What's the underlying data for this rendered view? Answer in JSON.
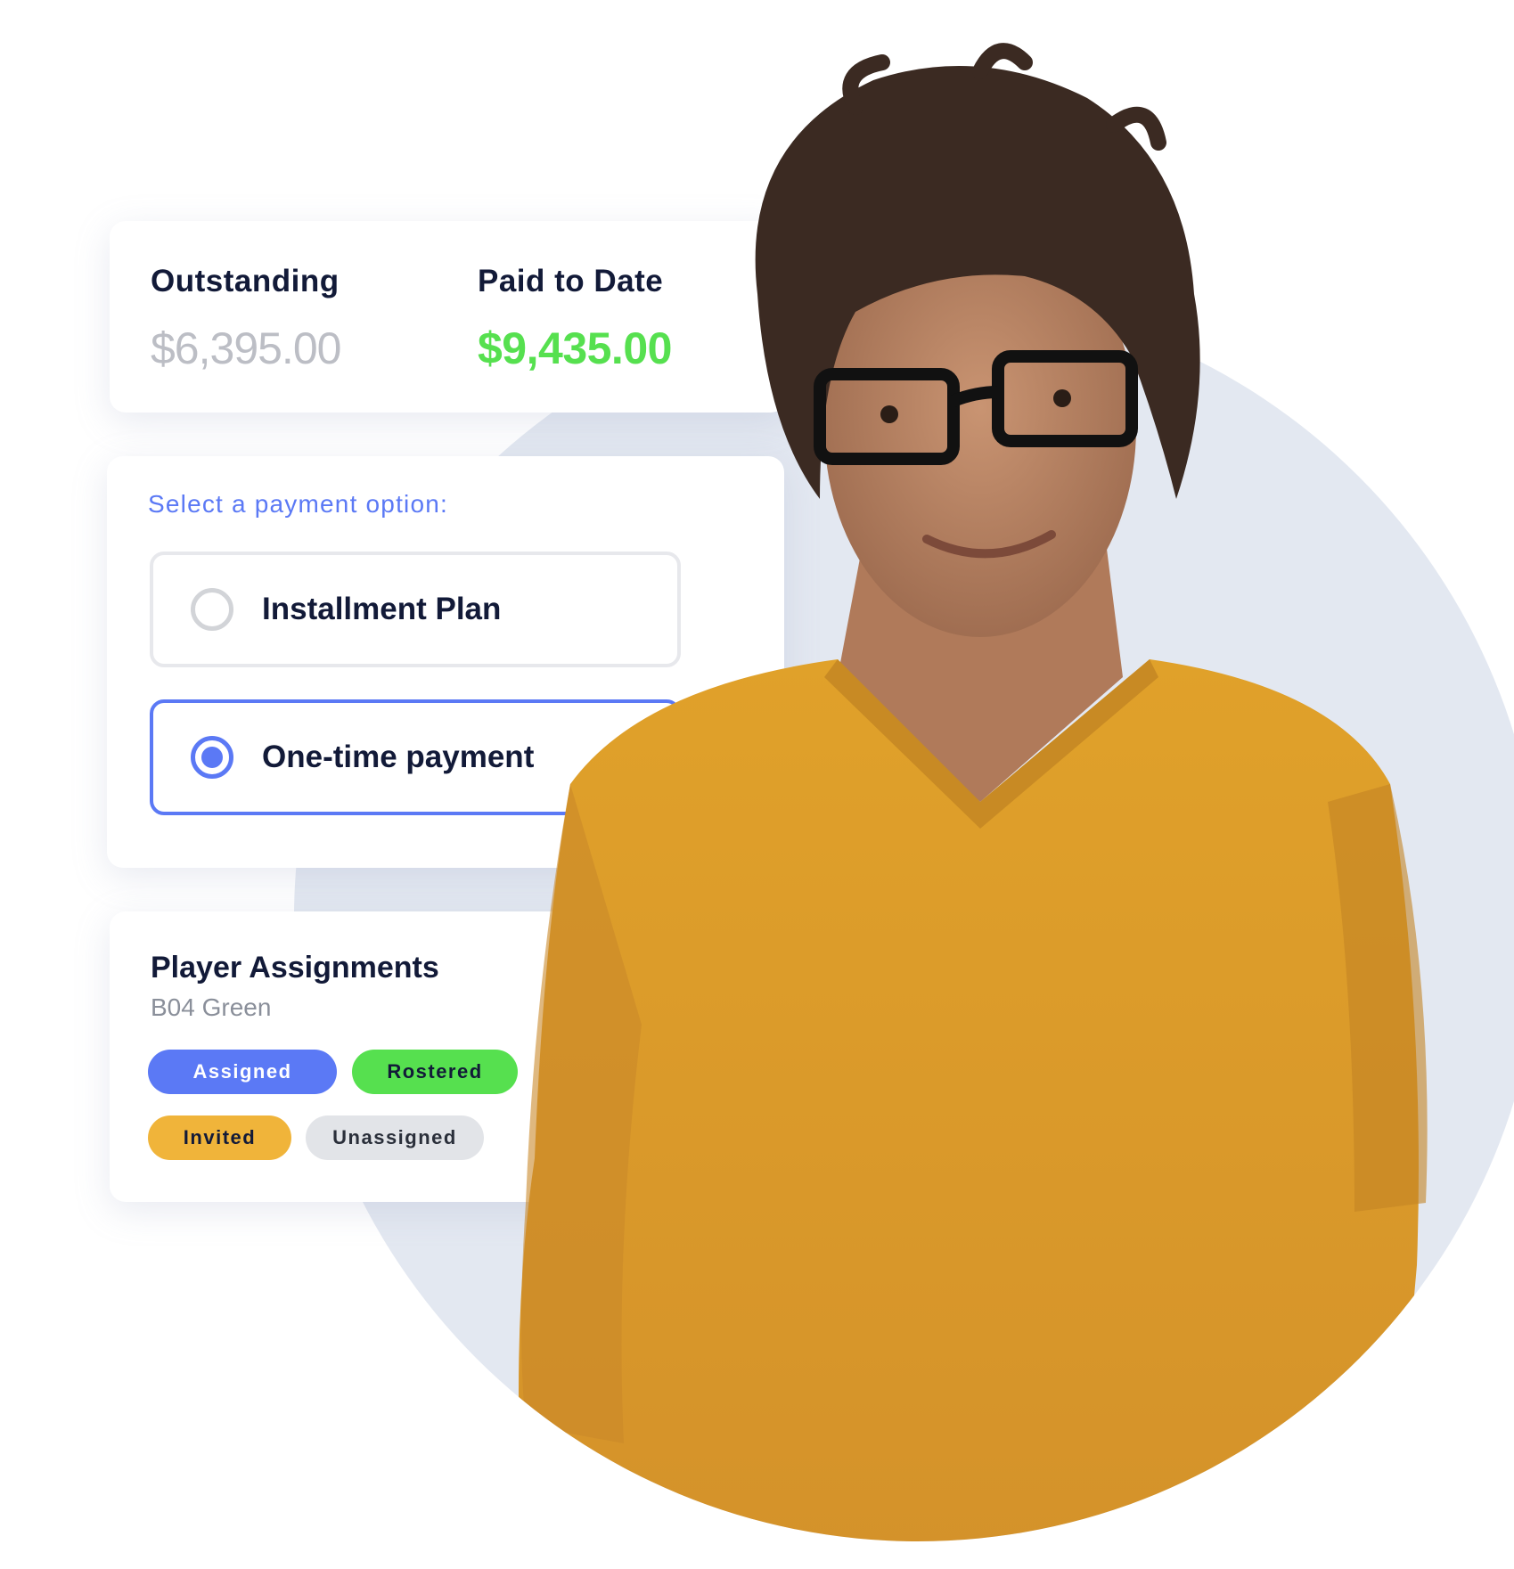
{
  "balance": {
    "outstanding_label": "Outstanding",
    "outstanding_value": "$6,395.00",
    "paid_label": "Paid to Date",
    "paid_value": "$9,435.00"
  },
  "payment": {
    "prompt": "Select a payment option:",
    "options": [
      {
        "label": "Installment Plan",
        "selected": false
      },
      {
        "label": "One-time payment",
        "selected": true
      }
    ]
  },
  "players": {
    "title": "Player Assignments",
    "team": "B04 Green",
    "statuses": [
      {
        "label": "Assigned",
        "color": "#5b79f5"
      },
      {
        "label": "Rostered",
        "color": "#56e04f"
      },
      {
        "label": "Invited",
        "color": "#f0b43a"
      },
      {
        "label": "Unassigned",
        "color": "#e2e4e8"
      }
    ]
  },
  "photo": {
    "subject": "smiling woman with curly short hair, black glasses, mustard-yellow sweater"
  },
  "colors": {
    "accent": "#5b79f5",
    "success": "#56e04f",
    "muted": "#bcbec5",
    "text": "#121a38",
    "backdrop": "#e3e8f1"
  }
}
